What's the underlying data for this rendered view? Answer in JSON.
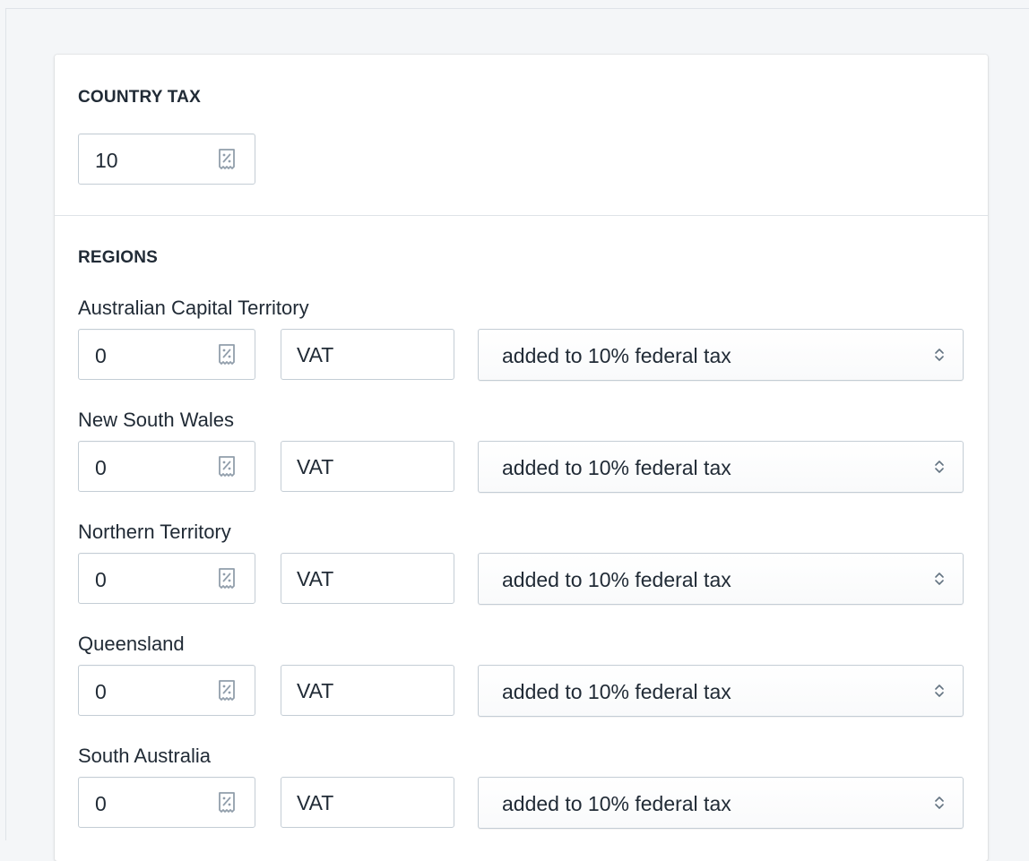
{
  "country_tax": {
    "heading": "COUNTRY TAX",
    "rate_value": "10",
    "rate_icon": "percent-receipt-icon"
  },
  "regions": {
    "heading": "REGIONS",
    "items": [
      {
        "name": "Australian Capital Territory",
        "rate": "0",
        "tax_name": "VAT",
        "mode": "added to 10% federal tax"
      },
      {
        "name": "New South Wales",
        "rate": "0",
        "tax_name": "VAT",
        "mode": "added to 10% federal tax"
      },
      {
        "name": "Northern Territory",
        "rate": "0",
        "tax_name": "VAT",
        "mode": "added to 10% federal tax"
      },
      {
        "name": "Queensland",
        "rate": "0",
        "tax_name": "VAT",
        "mode": "added to 10% federal tax"
      },
      {
        "name": "South Australia",
        "rate": "0",
        "tax_name": "VAT",
        "mode": "added to 10% federal tax"
      }
    ]
  },
  "colors": {
    "background": "#f4f6f8",
    "card": "#ffffff",
    "border": "#c4cdd5",
    "text": "#212b36",
    "icon": "#919eab"
  }
}
